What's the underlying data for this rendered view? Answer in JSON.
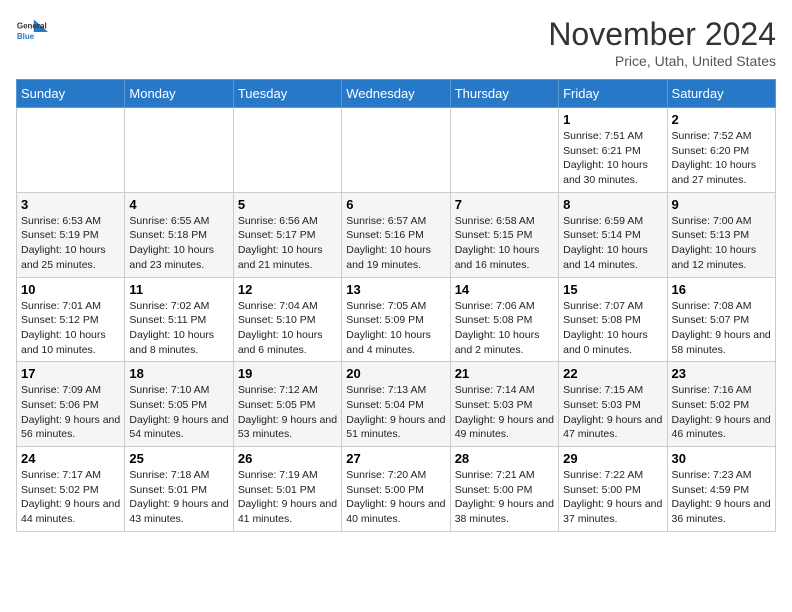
{
  "header": {
    "logo_general": "General",
    "logo_blue": "Blue",
    "month_title": "November 2024",
    "subtitle": "Price, Utah, United States"
  },
  "days_of_week": [
    "Sunday",
    "Monday",
    "Tuesday",
    "Wednesday",
    "Thursday",
    "Friday",
    "Saturday"
  ],
  "weeks": [
    [
      {
        "day": "",
        "info": ""
      },
      {
        "day": "",
        "info": ""
      },
      {
        "day": "",
        "info": ""
      },
      {
        "day": "",
        "info": ""
      },
      {
        "day": "",
        "info": ""
      },
      {
        "day": "1",
        "info": "Sunrise: 7:51 AM\nSunset: 6:21 PM\nDaylight: 10 hours and 30 minutes."
      },
      {
        "day": "2",
        "info": "Sunrise: 7:52 AM\nSunset: 6:20 PM\nDaylight: 10 hours and 27 minutes."
      }
    ],
    [
      {
        "day": "3",
        "info": "Sunrise: 6:53 AM\nSunset: 5:19 PM\nDaylight: 10 hours and 25 minutes."
      },
      {
        "day": "4",
        "info": "Sunrise: 6:55 AM\nSunset: 5:18 PM\nDaylight: 10 hours and 23 minutes."
      },
      {
        "day": "5",
        "info": "Sunrise: 6:56 AM\nSunset: 5:17 PM\nDaylight: 10 hours and 21 minutes."
      },
      {
        "day": "6",
        "info": "Sunrise: 6:57 AM\nSunset: 5:16 PM\nDaylight: 10 hours and 19 minutes."
      },
      {
        "day": "7",
        "info": "Sunrise: 6:58 AM\nSunset: 5:15 PM\nDaylight: 10 hours and 16 minutes."
      },
      {
        "day": "8",
        "info": "Sunrise: 6:59 AM\nSunset: 5:14 PM\nDaylight: 10 hours and 14 minutes."
      },
      {
        "day": "9",
        "info": "Sunrise: 7:00 AM\nSunset: 5:13 PM\nDaylight: 10 hours and 12 minutes."
      }
    ],
    [
      {
        "day": "10",
        "info": "Sunrise: 7:01 AM\nSunset: 5:12 PM\nDaylight: 10 hours and 10 minutes."
      },
      {
        "day": "11",
        "info": "Sunrise: 7:02 AM\nSunset: 5:11 PM\nDaylight: 10 hours and 8 minutes."
      },
      {
        "day": "12",
        "info": "Sunrise: 7:04 AM\nSunset: 5:10 PM\nDaylight: 10 hours and 6 minutes."
      },
      {
        "day": "13",
        "info": "Sunrise: 7:05 AM\nSunset: 5:09 PM\nDaylight: 10 hours and 4 minutes."
      },
      {
        "day": "14",
        "info": "Sunrise: 7:06 AM\nSunset: 5:08 PM\nDaylight: 10 hours and 2 minutes."
      },
      {
        "day": "15",
        "info": "Sunrise: 7:07 AM\nSunset: 5:08 PM\nDaylight: 10 hours and 0 minutes."
      },
      {
        "day": "16",
        "info": "Sunrise: 7:08 AM\nSunset: 5:07 PM\nDaylight: 9 hours and 58 minutes."
      }
    ],
    [
      {
        "day": "17",
        "info": "Sunrise: 7:09 AM\nSunset: 5:06 PM\nDaylight: 9 hours and 56 minutes."
      },
      {
        "day": "18",
        "info": "Sunrise: 7:10 AM\nSunset: 5:05 PM\nDaylight: 9 hours and 54 minutes."
      },
      {
        "day": "19",
        "info": "Sunrise: 7:12 AM\nSunset: 5:05 PM\nDaylight: 9 hours and 53 minutes."
      },
      {
        "day": "20",
        "info": "Sunrise: 7:13 AM\nSunset: 5:04 PM\nDaylight: 9 hours and 51 minutes."
      },
      {
        "day": "21",
        "info": "Sunrise: 7:14 AM\nSunset: 5:03 PM\nDaylight: 9 hours and 49 minutes."
      },
      {
        "day": "22",
        "info": "Sunrise: 7:15 AM\nSunset: 5:03 PM\nDaylight: 9 hours and 47 minutes."
      },
      {
        "day": "23",
        "info": "Sunrise: 7:16 AM\nSunset: 5:02 PM\nDaylight: 9 hours and 46 minutes."
      }
    ],
    [
      {
        "day": "24",
        "info": "Sunrise: 7:17 AM\nSunset: 5:02 PM\nDaylight: 9 hours and 44 minutes."
      },
      {
        "day": "25",
        "info": "Sunrise: 7:18 AM\nSunset: 5:01 PM\nDaylight: 9 hours and 43 minutes."
      },
      {
        "day": "26",
        "info": "Sunrise: 7:19 AM\nSunset: 5:01 PM\nDaylight: 9 hours and 41 minutes."
      },
      {
        "day": "27",
        "info": "Sunrise: 7:20 AM\nSunset: 5:00 PM\nDaylight: 9 hours and 40 minutes."
      },
      {
        "day": "28",
        "info": "Sunrise: 7:21 AM\nSunset: 5:00 PM\nDaylight: 9 hours and 38 minutes."
      },
      {
        "day": "29",
        "info": "Sunrise: 7:22 AM\nSunset: 5:00 PM\nDaylight: 9 hours and 37 minutes."
      },
      {
        "day": "30",
        "info": "Sunrise: 7:23 AM\nSunset: 4:59 PM\nDaylight: 9 hours and 36 minutes."
      }
    ]
  ]
}
